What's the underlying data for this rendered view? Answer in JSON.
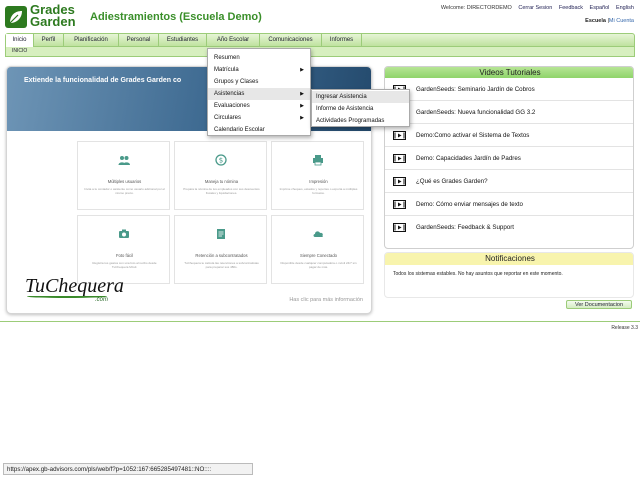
{
  "header": {
    "logo_line1": "Grades",
    "logo_line2": "Garden",
    "title": "Adiestramientos (Escuela Demo)",
    "welcome": "Welcome: DIRECTORDEMO",
    "logout": "Cerrar Sesion",
    "feedback": "Feedback",
    "lang_es": "Español",
    "lang_en": "English",
    "school": "Escuela",
    "separator": "|",
    "account": "Mi Cuenta"
  },
  "nav": {
    "items": [
      "Inicio",
      "Perfil",
      "Planificación",
      "Personal",
      "Estudiantes",
      "Año Escolar",
      "Comunicaciones",
      "Informes"
    ],
    "active": "Inicio",
    "sub": "INICIO"
  },
  "dropdown": {
    "items": [
      {
        "label": "Resumen",
        "arrow": ""
      },
      {
        "label": "Matrícula",
        "arrow": "▶"
      },
      {
        "label": "Grupos y Clases",
        "arrow": ""
      },
      {
        "label": "Asistencias",
        "arrow": "▶"
      },
      {
        "label": "Evaluaciones",
        "arrow": "▶"
      },
      {
        "label": "Circulares",
        "arrow": "▶"
      },
      {
        "label": "Calendario Escolar",
        "arrow": ""
      }
    ],
    "submenu": [
      "Ingresar Asistencia",
      "Informe de Asistencia",
      "Actividades Programadas"
    ]
  },
  "promo": {
    "banner": "Extiende la funcionalidad de Grades Garden co",
    "cards": [
      {
        "title": "Múltiples usuarios",
        "desc": "Invita a tu contador o asistente como usuario adicional por el mismo precio."
      },
      {
        "title": "Maneja tu nómina",
        "desc": "Prepara la nómina de tus empleados con sus descuentos fiscales y liquidaciones."
      },
      {
        "title": "Impresión",
        "desc": "Imprime cheques, estados y reportes o exporta a múltiples formatos."
      },
      {
        "title": "Foto fácil",
        "desc": "Registra tus gastos con una foto al recibo desde TuChequera Móvil."
      },
      {
        "title": "Retención a subcontratados",
        "desc": "TuChequera te calcula las retenciones a subcontratistas para preparar sus 480s."
      },
      {
        "title": "Siempre Conectado",
        "desc": "Disponible desde cualquier computadora o móvil 24/7 sin pagar de más."
      }
    ],
    "brand": "TuChequera",
    "brand_suffix": ".com",
    "more": "Has clic para más información"
  },
  "videos": {
    "title": "Videos Tutoriales",
    "items": [
      "GardenSeeds: Seminario Jardín de Cobros",
      "GardenSeeds: Nueva funcionalidad GG 3.2",
      "Demo:Como activar el Sistema de Textos",
      "Demo: Capacidades Jardín de Padres",
      "¿Qué es Grades Garden?",
      "Demo: Cómo enviar mensajes de texto",
      "GardenSeeds: Feedback & Support"
    ]
  },
  "notifications": {
    "title": "Notificaciones",
    "text": "Todos los sistemas estables. No hay asuntos que reportar en este momento."
  },
  "doc_button": "Ver Documentacion",
  "release": "Release 3.3",
  "status_url": "https://apex.gb-advisors.com/pls/web/f?p=1052:167:665285497481::NO::::",
  "colors": {
    "brand_green": "#2d7a1f",
    "nav_green": "#bfe29f",
    "banner_blue": "#3e6a91",
    "notif_yellow": "#f8f4ad"
  }
}
